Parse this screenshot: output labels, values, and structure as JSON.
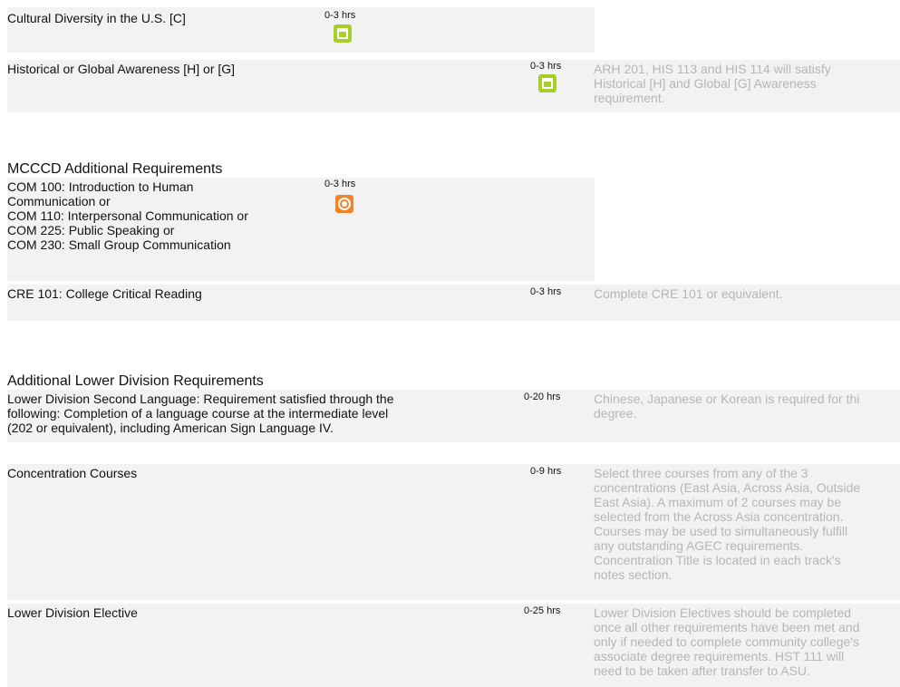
{
  "rows_top": [
    {
      "title": "Cultural Diversity in the U.S. [C]",
      "hours": "0-3 hrs",
      "icon": "green-document-star-icon"
    },
    {
      "title": "Historical or Global Awareness [H] or [G]",
      "hours": "0-3 hrs",
      "icon": "green-document-star-icon",
      "note_lines": [
        "ARH 201, HIS 113 and HIS 114 will satisfy",
        "Historical [H] and Global [G] Awareness",
        "requirement."
      ]
    }
  ],
  "mcccd": {
    "heading": "MCCCD Additional Requirements",
    "com": {
      "lines": [
        "COM 100: Introduction to Human",
        "Communication or",
        "COM 110: Interpersonal Communication or",
        "COM 225: Public Speaking or",
        "COM 230: Small Group Communication"
      ],
      "hours": "0-3 hrs",
      "icon": "orange-target-icon"
    },
    "cre": {
      "title": "CRE 101: College Critical Reading",
      "hours": "0-3 hrs",
      "note": "Complete CRE 101 or equivalent."
    }
  },
  "additional": {
    "heading": "Additional Lower Division Requirements",
    "second_language": {
      "lines": [
        "Lower Division Second Language: Requirement satisfied through the",
        "following: Completion of a language course at the intermediate level",
        "(202 or equivalent), including American Sign Language IV."
      ],
      "hours": "0-20 hrs",
      "note_lines": [
        "Chinese, Japanese or Korean is required for thi",
        "degree."
      ]
    },
    "concentration": {
      "title": "Concentration Courses",
      "hours": "0-9 hrs",
      "note_lines": [
        "Select three courses from any of the 3",
        "concentrations (East Asia, Across Asia, Outside",
        "East Asia). A maximum of 2 courses may be",
        "selected from the Across Asia concentration.",
        "Courses may be used to simultaneously fulfill",
        "any outstanding AGEC requirements.",
        "Concentration Title is located in each track's",
        "notes section."
      ]
    },
    "elective": {
      "title": "Lower Division Elective",
      "hours": "0-25 hrs",
      "note_lines": [
        "Lower Division Electives should be completed",
        "once all other requirements have been met and",
        "only if needed to complete community college's",
        "associate degree requirements. HST 111 will",
        "need to be taken after transfer to ASU."
      ]
    }
  }
}
